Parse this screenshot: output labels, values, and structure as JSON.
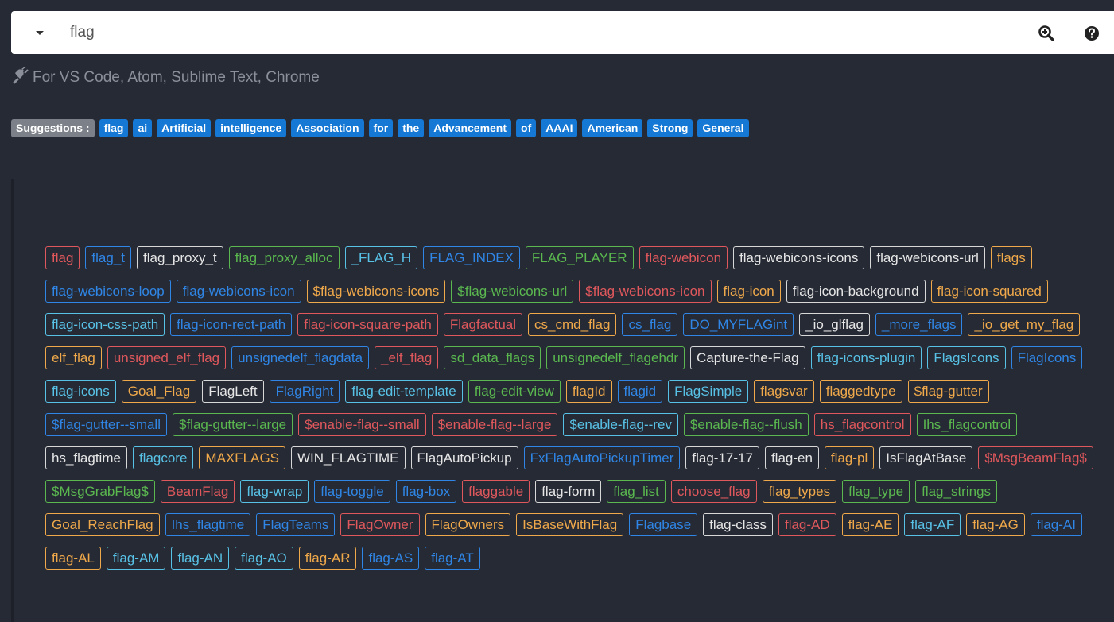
{
  "search": {
    "value": "flag"
  },
  "plugin_text": "For VS Code, Atom, Sublime Text, Chrome",
  "suggestions": {
    "label": "Suggestions :",
    "items": [
      "flag",
      "ai",
      "Artificial",
      "intelligence",
      "Association",
      "for",
      "the",
      "Advancement",
      "of",
      "AAAI",
      "American",
      "Strong",
      "General"
    ]
  },
  "colors": {
    "background": "#262a35",
    "suggestion": "#1478d4",
    "red": "#e0585c",
    "blue": "#2f86e6",
    "white": "#e6e6e6",
    "green": "#5ab84f",
    "orange": "#f0a94a",
    "cyan": "#58c2e6"
  },
  "icons": {
    "dropdown": "caret-down-icon",
    "zoom": "zoom-in-icon",
    "help": "help-circle-icon",
    "plugin": "plug-icon"
  },
  "results": [
    {
      "text": "flag",
      "color": "red"
    },
    {
      "text": "flag_t",
      "color": "blue"
    },
    {
      "text": "flag_proxy_t",
      "color": "white"
    },
    {
      "text": "flag_proxy_alloc",
      "color": "green"
    },
    {
      "text": "_FLAG_H",
      "color": "cyan"
    },
    {
      "text": "FLAG_INDEX",
      "color": "blue"
    },
    {
      "text": "FLAG_PLAYER",
      "color": "green"
    },
    {
      "text": "flag-webicon",
      "color": "red"
    },
    {
      "text": "flag-webicons-icons",
      "color": "white"
    },
    {
      "text": "flag-webicons-url",
      "color": "white"
    },
    {
      "text": "flags",
      "color": "orange"
    },
    {
      "text": "flag-webicons-loop",
      "color": "blue"
    },
    {
      "text": "flag-webicons-icon",
      "color": "blue"
    },
    {
      "text": "$flag-webicons-icons",
      "color": "orange"
    },
    {
      "text": "$flag-webicons-url",
      "color": "green"
    },
    {
      "text": "$flag-webicons-icon",
      "color": "red"
    },
    {
      "text": "flag-icon",
      "color": "orange"
    },
    {
      "text": "flag-icon-background",
      "color": "white"
    },
    {
      "text": "flag-icon-squared",
      "color": "orange"
    },
    {
      "text": "flag-icon-css-path",
      "color": "cyan"
    },
    {
      "text": "flag-icon-rect-path",
      "color": "blue"
    },
    {
      "text": "flag-icon-square-path",
      "color": "red"
    },
    {
      "text": "Flagfactual",
      "color": "red"
    },
    {
      "text": "cs_cmd_flag",
      "color": "orange"
    },
    {
      "text": "cs_flag",
      "color": "blue"
    },
    {
      "text": "DO_MYFLAGint",
      "color": "blue"
    },
    {
      "text": "_io_glflag",
      "color": "white"
    },
    {
      "text": "_more_flags",
      "color": "blue"
    },
    {
      "text": "_io_get_my_flag",
      "color": "orange"
    },
    {
      "text": "elf_flag",
      "color": "orange"
    },
    {
      "text": "unsigned_elf_flag",
      "color": "red"
    },
    {
      "text": "unsignedelf_flagdata",
      "color": "blue"
    },
    {
      "text": "_elf_flag",
      "color": "red"
    },
    {
      "text": "sd_data_flags",
      "color": "green"
    },
    {
      "text": "unsignedelf_flagehdr",
      "color": "green"
    },
    {
      "text": "Capture-the-Flag",
      "color": "white"
    },
    {
      "text": "flag-icons-plugin",
      "color": "cyan"
    },
    {
      "text": "FlagsIcons",
      "color": "cyan"
    },
    {
      "text": "FlagIcons",
      "color": "blue"
    },
    {
      "text": "flag-icons",
      "color": "cyan"
    },
    {
      "text": "Goal_Flag",
      "color": "orange"
    },
    {
      "text": "FlagLeft",
      "color": "white"
    },
    {
      "text": "FlagRight",
      "color": "blue"
    },
    {
      "text": "flag-edit-template",
      "color": "cyan"
    },
    {
      "text": "flag-edit-view",
      "color": "green"
    },
    {
      "text": "flagId",
      "color": "orange"
    },
    {
      "text": "flagid",
      "color": "blue"
    },
    {
      "text": "FlagSimple",
      "color": "cyan"
    },
    {
      "text": "flagsvar",
      "color": "orange"
    },
    {
      "text": "flaggedtype",
      "color": "orange"
    },
    {
      "text": "$flag-gutter",
      "color": "orange"
    },
    {
      "text": "$flag-gutter--small",
      "color": "blue"
    },
    {
      "text": "$flag-gutter--large",
      "color": "green"
    },
    {
      "text": "$enable-flag--small",
      "color": "red"
    },
    {
      "text": "$enable-flag--large",
      "color": "red"
    },
    {
      "text": "$enable-flag--rev",
      "color": "cyan"
    },
    {
      "text": "$enable-flag--flush",
      "color": "green"
    },
    {
      "text": "hs_flagcontrol",
      "color": "red"
    },
    {
      "text": "Ihs_flagcontrol",
      "color": "green"
    },
    {
      "text": "hs_flagtime",
      "color": "white"
    },
    {
      "text": "flagcore",
      "color": "cyan"
    },
    {
      "text": "MAXFLAGS",
      "color": "orange"
    },
    {
      "text": "WIN_FLAGTIME",
      "color": "white"
    },
    {
      "text": "FlagAutoPickup",
      "color": "white"
    },
    {
      "text": "FxFlagAutoPickupTimer",
      "color": "blue"
    },
    {
      "text": "flag-17-17",
      "color": "white"
    },
    {
      "text": "flag-en",
      "color": "white"
    },
    {
      "text": "flag-pl",
      "color": "orange"
    },
    {
      "text": "IsFlagAtBase",
      "color": "white"
    },
    {
      "text": "$MsgBeamFlag$",
      "color": "red"
    },
    {
      "text": "$MsgGrabFlag$",
      "color": "green"
    },
    {
      "text": "BeamFlag",
      "color": "red"
    },
    {
      "text": "flag-wrap",
      "color": "cyan"
    },
    {
      "text": "flag-toggle",
      "color": "blue"
    },
    {
      "text": "flag-box",
      "color": "blue"
    },
    {
      "text": "flaggable",
      "color": "red"
    },
    {
      "text": "flag-form",
      "color": "white"
    },
    {
      "text": "flag_list",
      "color": "green"
    },
    {
      "text": "choose_flag",
      "color": "red"
    },
    {
      "text": "flag_types",
      "color": "orange"
    },
    {
      "text": "flag_type",
      "color": "green"
    },
    {
      "text": "flag_strings",
      "color": "green"
    },
    {
      "text": "Goal_ReachFlag",
      "color": "orange"
    },
    {
      "text": "Ihs_flagtime",
      "color": "blue"
    },
    {
      "text": "FlagTeams",
      "color": "blue"
    },
    {
      "text": "FlagOwner",
      "color": "red"
    },
    {
      "text": "FlagOwners",
      "color": "orange"
    },
    {
      "text": "IsBaseWithFlag",
      "color": "orange"
    },
    {
      "text": "Flagbase",
      "color": "blue"
    },
    {
      "text": "flag-class",
      "color": "white"
    },
    {
      "text": "flag-AD",
      "color": "red"
    },
    {
      "text": "flag-AE",
      "color": "orange"
    },
    {
      "text": "flag-AF",
      "color": "cyan"
    },
    {
      "text": "flag-AG",
      "color": "orange"
    },
    {
      "text": "flag-AI",
      "color": "blue"
    },
    {
      "text": "flag-AL",
      "color": "orange"
    },
    {
      "text": "flag-AM",
      "color": "cyan"
    },
    {
      "text": "flag-AN",
      "color": "cyan"
    },
    {
      "text": "flag-AO",
      "color": "cyan"
    },
    {
      "text": "flag-AR",
      "color": "orange"
    },
    {
      "text": "flag-AS",
      "color": "blue"
    },
    {
      "text": "flag-AT",
      "color": "blue"
    }
  ]
}
